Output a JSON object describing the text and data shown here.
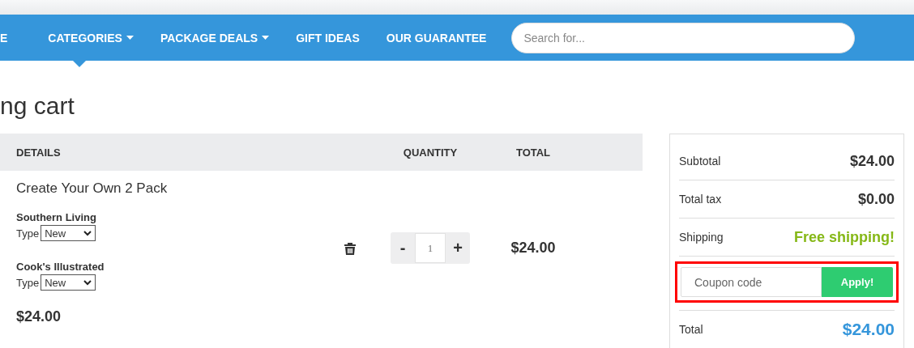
{
  "nav": {
    "items": [
      {
        "label": "E",
        "caret": false,
        "selected": false
      },
      {
        "label": "CATEGORIES",
        "caret": true,
        "selected": true
      },
      {
        "label": "PACKAGE DEALS",
        "caret": true,
        "selected": false
      },
      {
        "label": "GIFT IDEAS",
        "caret": false,
        "selected": false
      },
      {
        "label": "OUR GUARANTEE",
        "caret": false,
        "selected": false
      }
    ],
    "search": {
      "placeholder": "Search for..."
    }
  },
  "page_title": "ng cart",
  "cart": {
    "columns": [
      "DETAILS",
      "QUANTITY",
      "TOTAL"
    ],
    "item": {
      "name": "Create Your Own 2 Pack",
      "products": [
        {
          "name": "Southern Living",
          "type_label": "Type",
          "type_value": "New"
        },
        {
          "name": "Cook's Illustrated",
          "type_label": "Type",
          "type_value": "New"
        }
      ],
      "price": "$24.00",
      "quantity": "1",
      "decrease": "-",
      "increase": "+",
      "total": "$24.00"
    }
  },
  "summary": {
    "rows": [
      {
        "label": "Subtotal",
        "value": "$24.00",
        "kind": "amount"
      },
      {
        "label": "Total tax",
        "value": "$0.00",
        "kind": "amount"
      },
      {
        "label": "Shipping",
        "value": "Free shipping!",
        "kind": "free"
      }
    ],
    "coupon": {
      "placeholder": "Coupon code",
      "button": "Apply!",
      "highlighted": true
    },
    "total": {
      "label": "Total",
      "value": "$24.00"
    }
  }
}
